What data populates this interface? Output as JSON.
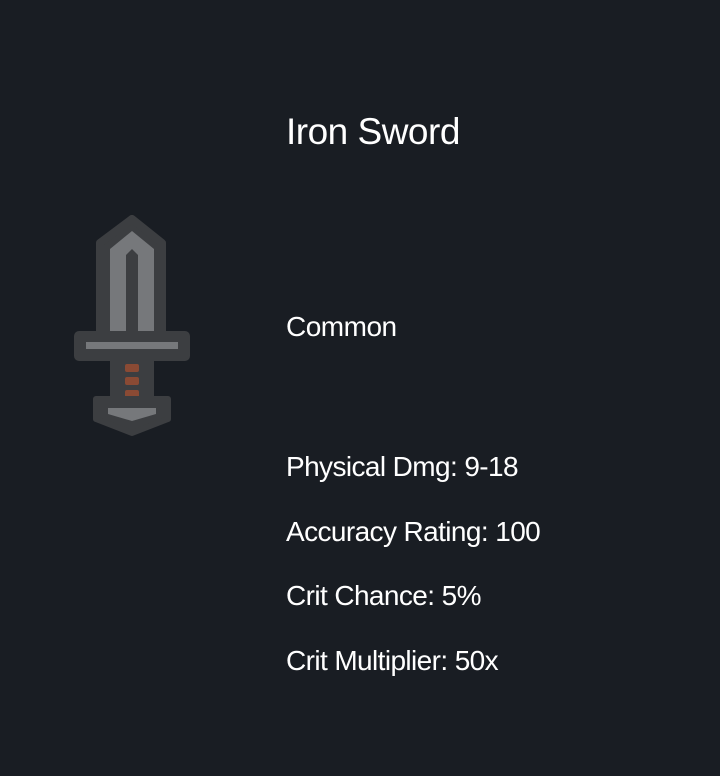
{
  "item": {
    "name": "Iron Sword",
    "rarity": "Common",
    "icon": "sword-icon",
    "stats": [
      "Physical Dmg: 9-18",
      "Accuracy Rating: 100",
      "Crit Chance: 5%",
      "Crit Multiplier: 50x"
    ]
  },
  "colors": {
    "background": "#191d23",
    "text": "#ffffff",
    "blade": "#76787b",
    "outline": "#3c3e41",
    "grip_wrap": "#8a4a34"
  }
}
